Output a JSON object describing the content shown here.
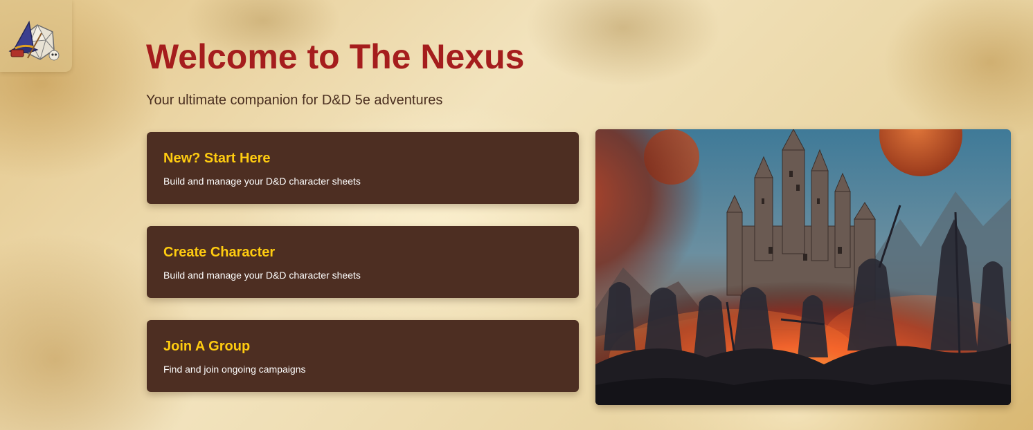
{
  "header": {
    "title": "Welcome to The Nexus",
    "subtitle": "Your ultimate companion for D&D 5e adventures"
  },
  "logo": {
    "icon": "wizard-dice-logo-icon"
  },
  "cards": [
    {
      "title": "New? Start Here",
      "description": "Build and manage your D&D character sheets"
    },
    {
      "title": "Create Character",
      "description": "Build and manage your D&D character sheets"
    },
    {
      "title": "Join A Group",
      "description": "Find and join ongoing campaigns"
    }
  ],
  "hero_image": {
    "subject": "fantasy castle over fiery battlefield with silhouetted adventurers"
  },
  "colors": {
    "title": "#a51d1d",
    "card_background": "#4d2e22",
    "card_title": "#ffcc10",
    "card_text": "#ffffff",
    "subtitle": "#4a2e1f"
  }
}
